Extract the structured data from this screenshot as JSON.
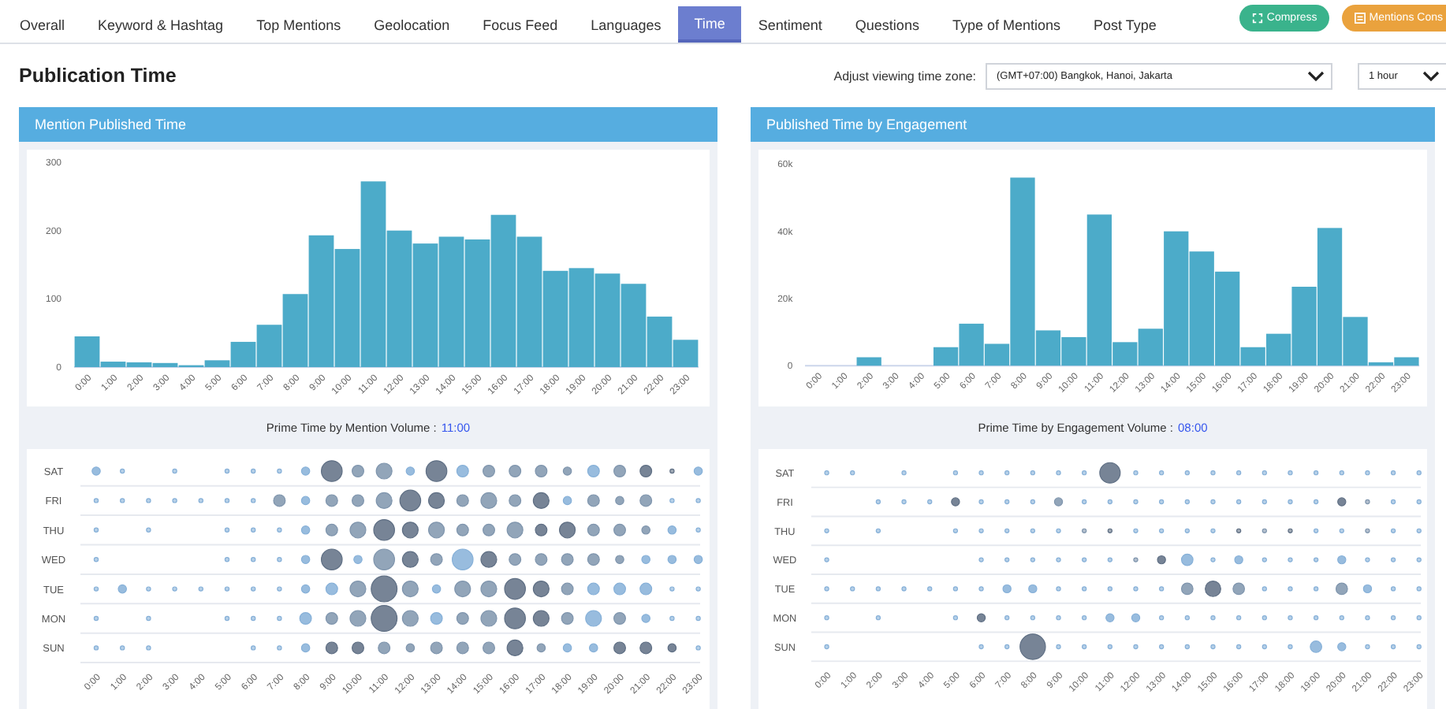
{
  "tabs": [
    {
      "label": "Overall",
      "selected": false
    },
    {
      "label": "Keyword & Hashtag",
      "selected": false
    },
    {
      "label": "Top Mentions",
      "selected": false
    },
    {
      "label": "Geolocation",
      "selected": false
    },
    {
      "label": "Focus Feed",
      "selected": false
    },
    {
      "label": "Languages",
      "selected": false
    },
    {
      "label": "Time",
      "selected": true
    },
    {
      "label": "Sentiment",
      "selected": false
    },
    {
      "label": "Questions",
      "selected": false
    },
    {
      "label": "Type of Mentions",
      "selected": false
    },
    {
      "label": "Post Type",
      "selected": false
    }
  ],
  "buttons": [
    {
      "label": "Compress",
      "kind": "compress"
    },
    {
      "label": "Mentions Cons",
      "kind": "mentions"
    }
  ],
  "page_title": "Publication Time",
  "timezone": {
    "label": "Adjust viewing time zone:",
    "value": "(GMT+07:00) Bangkok, Hanoi, Jakarta"
  },
  "interval": {
    "value": "1 hour"
  },
  "panels": [
    {
      "title": "Mention Published Time",
      "chart_data": {
        "type": "bar",
        "categories": [
          "0:00",
          "1:00",
          "2:00",
          "3:00",
          "4:00",
          "5:00",
          "6:00",
          "7:00",
          "8:00",
          "9:00",
          "10:00",
          "11:00",
          "12:00",
          "13:00",
          "14:00",
          "15:00",
          "16:00",
          "17:00",
          "18:00",
          "19:00",
          "20:00",
          "21:00",
          "22:00",
          "23:00"
        ],
        "values": [
          45,
          8,
          7,
          6,
          1,
          10,
          37,
          62,
          107,
          193,
          173,
          272,
          200,
          181,
          191,
          187,
          223,
          191,
          141,
          145,
          137,
          122,
          74,
          40
        ],
        "ylim": [
          0,
          300
        ],
        "yticks": [
          0,
          100,
          200,
          300
        ]
      },
      "prime_label": "Prime Time by Mention Volume :",
      "prime_value": "11:00",
      "heatmap": {
        "days": [
          "SAT",
          "FRI",
          "THU",
          "WED",
          "TUE",
          "MON",
          "SUN"
        ],
        "hours": [
          "0:00",
          "1:00",
          "2:00",
          "3:00",
          "4:00",
          "5:00",
          "6:00",
          "7:00",
          "8:00",
          "9:00",
          "10:00",
          "11:00",
          "12:00",
          "13:00",
          "14:00",
          "15:00",
          "16:00",
          "17:00",
          "18:00",
          "19:00",
          "20:00",
          "21:00",
          "22:00",
          "23:00"
        ]
      }
    },
    {
      "title": "Published Time by Engagement",
      "chart_data": {
        "type": "bar",
        "categories": [
          "0:00",
          "1:00",
          "2:00",
          "3:00",
          "4:00",
          "5:00",
          "6:00",
          "7:00",
          "8:00",
          "9:00",
          "10:00",
          "11:00",
          "12:00",
          "13:00",
          "14:00",
          "15:00",
          "16:00",
          "17:00",
          "18:00",
          "19:00",
          "20:00",
          "21:00",
          "22:00",
          "23:00"
        ],
        "values": [
          0,
          0,
          2500,
          0,
          0,
          5500,
          12500,
          6500,
          56000,
          10500,
          8500,
          45000,
          7000,
          11000,
          40000,
          34000,
          28000,
          5500,
          9500,
          23500,
          41000,
          14500,
          1000,
          2500
        ],
        "ylim": [
          0,
          60000
        ],
        "yticks": [
          0,
          {
            "value": 20000,
            "label": "20k"
          },
          {
            "value": 40000,
            "label": "40k"
          },
          {
            "value": 60000,
            "label": "60k"
          }
        ]
      },
      "prime_label": "Prime Time by Engagement Volume :",
      "prime_value": "08:00",
      "heatmap": {
        "days": [
          "SAT",
          "FRI",
          "THU",
          "WED",
          "TUE",
          "MON",
          "SUN"
        ],
        "hours": [
          "0:00",
          "1:00",
          "2:00",
          "3:00",
          "4:00",
          "5:00",
          "6:00",
          "7:00",
          "8:00",
          "9:00",
          "10:00",
          "11:00",
          "12:00",
          "13:00",
          "14:00",
          "15:00",
          "16:00",
          "17:00",
          "18:00",
          "19:00",
          "20:00",
          "21:00",
          "22:00",
          "23:00"
        ]
      }
    }
  ]
}
